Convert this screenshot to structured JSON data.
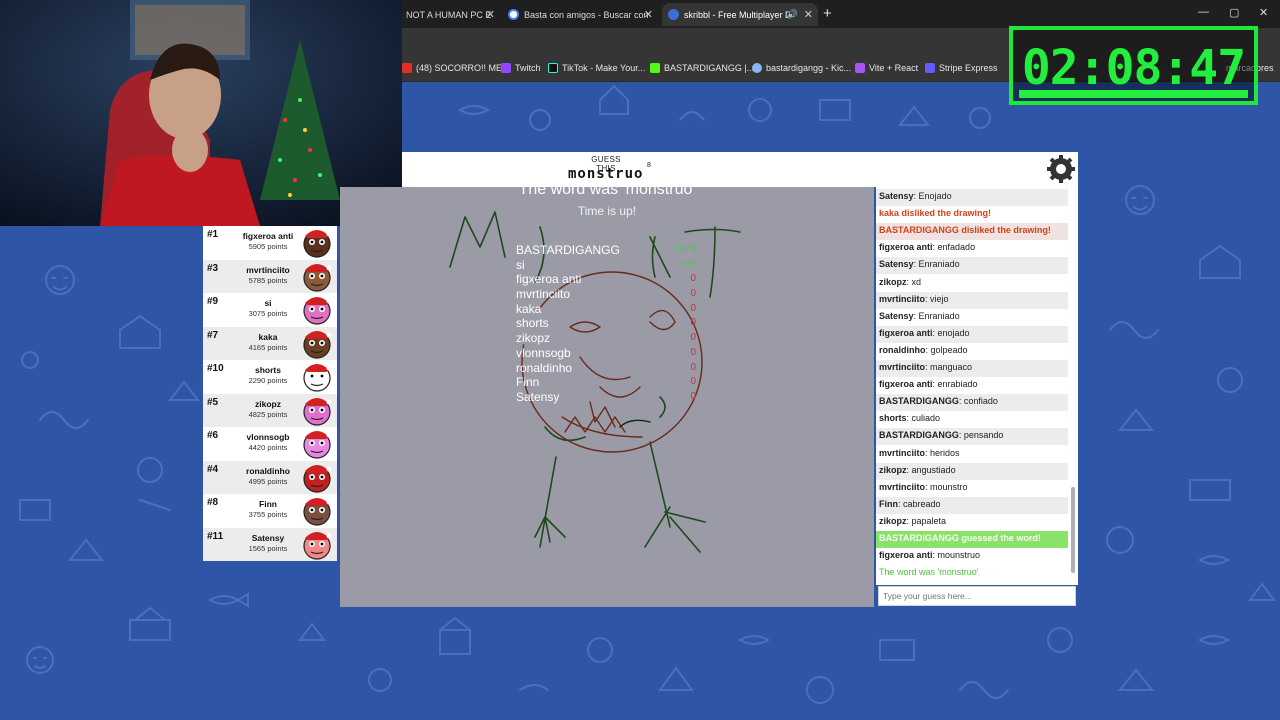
{
  "browser": {
    "tabs": [
      {
        "label": "NOT A HUMAN PC E",
        "active": false
      },
      {
        "label": "Basta con amigos - Buscar con",
        "active": false
      },
      {
        "label": "skribbl - Free Multiplayer D",
        "active": true
      }
    ],
    "bookmarks": [
      "(48) SOCORRO!! ME...",
      "Twitch",
      "TikTok - Make Your...",
      "BASTARDIGANGG |...",
      "bastardigangg - Kic...",
      "Vite + React",
      "Stripe Express",
      "marcadores"
    ]
  },
  "timer": {
    "text": "02:08:47"
  },
  "game": {
    "guess_label": "GUESS THIS",
    "word": "monstruo",
    "word_length": "8",
    "word_was": "The word was 'monstruo'",
    "time_up": "Time is up!"
  },
  "players": [
    {
      "rank": "#1",
      "name": "figxeroa anti",
      "points": "5905 points",
      "skin": "#5a3020"
    },
    {
      "rank": "#3",
      "name": "mvrtinciito",
      "points": "5785 points",
      "skin": "#8a5a3a"
    },
    {
      "rank": "#9",
      "name": "si",
      "points": "3075 points",
      "skin": "#e070c0"
    },
    {
      "rank": "#7",
      "name": "kaka",
      "points": "4165 points",
      "skin": "#6a4024"
    },
    {
      "rank": "#10",
      "name": "shorts",
      "points": "2290 points",
      "skin": "#ffffff"
    },
    {
      "rank": "#5",
      "name": "zikopz",
      "points": "4825 points",
      "skin": "#e070d0"
    },
    {
      "rank": "#6",
      "name": "vlonnsogb",
      "points": "4420 points",
      "skin": "#e888e0"
    },
    {
      "rank": "#4",
      "name": "ronaldinho",
      "points": "4995 points",
      "skin": "#c02020"
    },
    {
      "rank": "#8",
      "name": "Finn",
      "points": "3755 points",
      "skin": "#7a5040"
    },
    {
      "rank": "#11",
      "name": "Satensy",
      "points": "1565 points",
      "skin": "#f08888"
    }
  ],
  "player_bubble": "mounstruo",
  "round_scores": [
    {
      "name": "BASTARDIGANGG",
      "points": "+275",
      "positive": true
    },
    {
      "name": "si",
      "points": "+70",
      "positive": true
    },
    {
      "name": "figxeroa anti",
      "points": "0",
      "positive": false
    },
    {
      "name": "mvrtinciito",
      "points": "0",
      "positive": false
    },
    {
      "name": "kaka",
      "points": "0",
      "positive": false
    },
    {
      "name": "shorts",
      "points": "0",
      "positive": false
    },
    {
      "name": "zikopz",
      "points": "0",
      "positive": false
    },
    {
      "name": "vlonnsogb",
      "points": "0",
      "positive": false
    },
    {
      "name": "ronaldinho",
      "points": "0",
      "positive": false
    },
    {
      "name": "Finn",
      "points": "0",
      "positive": false
    },
    {
      "name": "Satensy",
      "points": "0",
      "positive": false
    }
  ],
  "chat": [
    {
      "name": "Satensy",
      "text": "Enojado",
      "type": "normal"
    },
    {
      "name": "",
      "text": "kaka disliked the drawing!",
      "type": "dislike"
    },
    {
      "name": "",
      "text": "BASTARDIGANGG disliked the drawing!",
      "type": "dislike"
    },
    {
      "name": "figxeroa anti",
      "text": "enfadado",
      "type": "normal"
    },
    {
      "name": "Satensy",
      "text": "Enraniado",
      "type": "normal"
    },
    {
      "name": "zikopz",
      "text": "xd",
      "type": "normal"
    },
    {
      "name": "mvrtinciito",
      "text": "viejo",
      "type": "normal"
    },
    {
      "name": "Satensy",
      "text": "Enraniado",
      "type": "normal"
    },
    {
      "name": "figxeroa anti",
      "text": "enojado",
      "type": "normal"
    },
    {
      "name": "ronaldinho",
      "text": "golpeado",
      "type": "normal"
    },
    {
      "name": "mvrtinciito",
      "text": "manguaco",
      "type": "normal"
    },
    {
      "name": "figxeroa anti",
      "text": "enrabiado",
      "type": "normal"
    },
    {
      "name": "BASTARDIGANGG",
      "text": "confiado",
      "type": "normal"
    },
    {
      "name": "shorts",
      "text": "culiado",
      "type": "normal"
    },
    {
      "name": "BASTARDIGANGG",
      "text": "pensando",
      "type": "normal"
    },
    {
      "name": "mvrtinciito",
      "text": "heridos",
      "type": "normal"
    },
    {
      "name": "zikopz",
      "text": "angustiado",
      "type": "normal"
    },
    {
      "name": "mvrtinciito",
      "text": "mounstro",
      "type": "normal"
    },
    {
      "name": "Finn",
      "text": "cabreado",
      "type": "normal"
    },
    {
      "name": "zikopz",
      "text": "papaleta",
      "type": "normal"
    },
    {
      "name": "",
      "text": "BASTARDIGANGG guessed the word!",
      "type": "guessed"
    },
    {
      "name": "figxeroa anti",
      "text": "mounstruo",
      "type": "normal"
    },
    {
      "name": "",
      "text": "The word was 'monstruo'",
      "type": "reveal"
    }
  ],
  "chat_input": {
    "placeholder": "Type your guess here..."
  },
  "colors": {
    "bg": "#2f56a6",
    "timer": "#22ee3e",
    "dislike": "#d0421c",
    "guessed": "#8be26a"
  }
}
